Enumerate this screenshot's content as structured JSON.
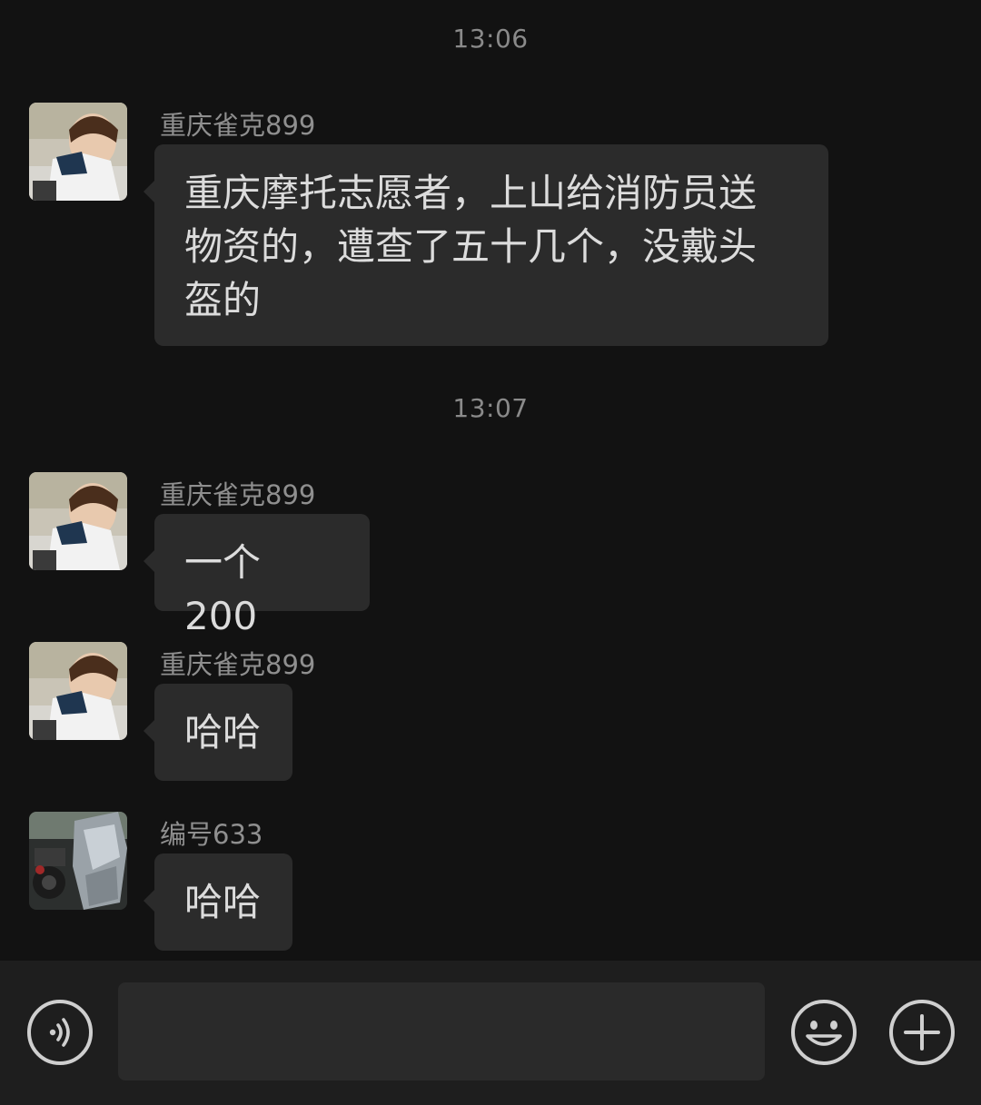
{
  "timestamps": [
    "13:06",
    "13:07"
  ],
  "messages": [
    {
      "sender": "重庆雀克899",
      "text": "重庆摩托志愿者，上山给消防员送\n物资的，遭查了五十几个，没戴头\n盔的",
      "avatar": "child-photo"
    },
    {
      "sender": "重庆雀克899",
      "text": "一个 200",
      "avatar": "child-photo"
    },
    {
      "sender": "重庆雀克899",
      "text": "哈哈",
      "avatar": "child-photo"
    },
    {
      "sender": "编号633",
      "text": "哈哈",
      "avatar": "motorcycle-photo"
    }
  ],
  "input_bar": {
    "message_input_value": "",
    "icons": [
      "voice-icon",
      "emoji-icon",
      "plus-icon"
    ]
  },
  "colors": {
    "background": "#121212",
    "bubble": "#2b2b2b",
    "input_bar": "#1e1e1e",
    "text": "#dcdcdc",
    "secondary_text": "#8f8f8f"
  }
}
